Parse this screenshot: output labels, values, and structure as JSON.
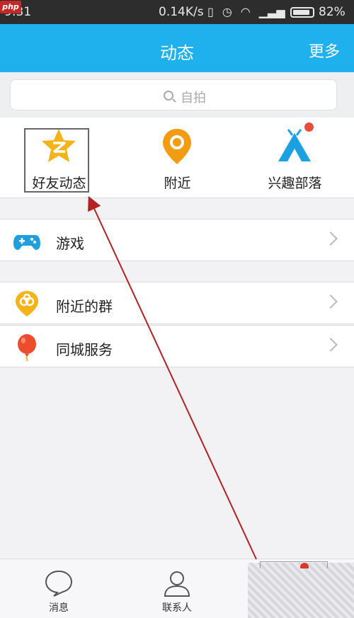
{
  "status_bar": {
    "time": "9:31",
    "network_speed": "0.14K/s",
    "battery": "82%",
    "icons": [
      "vibrate-icon",
      "alarm-icon",
      "wifi-icon",
      "signal-icon",
      "battery-icon"
    ],
    "watermark": "php"
  },
  "header": {
    "title": "动态",
    "more_label": "更多"
  },
  "search": {
    "placeholder": "自拍"
  },
  "feature_grid": [
    {
      "label": "好友动态",
      "icon": "qzone-star-icon"
    },
    {
      "label": "附近",
      "icon": "location-pin-icon"
    },
    {
      "label": "兴趣部落",
      "icon": "tent-icon"
    }
  ],
  "list": {
    "section1": [
      {
        "label": "游戏",
        "icon": "gamepad-icon"
      }
    ],
    "section2": [
      {
        "label": "附近的群",
        "icon": "nearby-group-icon"
      },
      {
        "label": "同城服务",
        "icon": "balloon-icon"
      }
    ]
  },
  "tab_bar": [
    {
      "label": "消息",
      "icon": "chat-bubble-icon"
    },
    {
      "label": "联系人",
      "icon": "contacts-icon"
    }
  ],
  "colors": {
    "accent": "#1fb1ee",
    "annotation": "#b22222",
    "badge": "#e84c3d"
  }
}
